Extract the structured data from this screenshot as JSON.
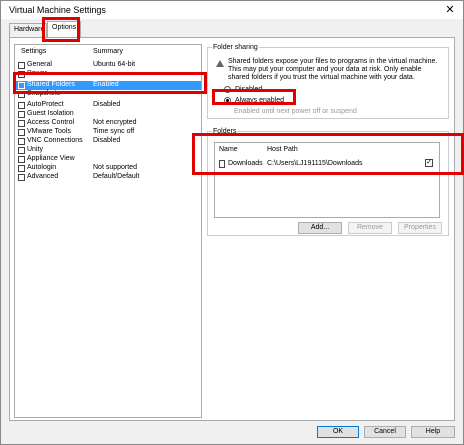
{
  "window": {
    "title": "Virtual Machine Settings",
    "close": "✕"
  },
  "tabs": [
    {
      "label": "Hardware"
    },
    {
      "label": "Options"
    }
  ],
  "list": {
    "header": {
      "settings": "Settings",
      "summary": "Summary"
    },
    "items": [
      {
        "name": "General",
        "value": "Ubuntu 64-bit",
        "icon": "general-icon"
      },
      {
        "name": "Power",
        "value": "",
        "icon": "power-icon"
      },
      {
        "name": "Shared Folders",
        "value": "Enabled",
        "icon": "shared-folders-icon",
        "selected": true
      },
      {
        "name": "Snapshots",
        "value": "",
        "icon": "snapshots-icon"
      },
      {
        "name": "AutoProtect",
        "value": "Disabled",
        "icon": "autoprotect-icon"
      },
      {
        "name": "Guest Isolation",
        "value": "",
        "icon": "guest-isolation-icon"
      },
      {
        "name": "Access Control",
        "value": "Not encrypted",
        "icon": "access-control-icon"
      },
      {
        "name": "VMware Tools",
        "value": "Time sync off",
        "icon": "vmware-tools-icon"
      },
      {
        "name": "VNC Connections",
        "value": "Disabled",
        "icon": "vnc-icon"
      },
      {
        "name": "Unity",
        "value": "",
        "icon": "unity-icon"
      },
      {
        "name": "Appliance View",
        "value": "",
        "icon": "appliance-view-icon"
      },
      {
        "name": "Autologin",
        "value": "Not supported",
        "icon": "autologin-icon"
      },
      {
        "name": "Advanced",
        "value": "Default/Default",
        "icon": "advanced-icon"
      }
    ]
  },
  "folder_sharing": {
    "legend": "Folder sharing",
    "warning": "Shared folders expose your files to programs in the virtual machine. This may put your computer and your data at risk. Only enable shared folders if you trust the virtual machine with your data.",
    "options": [
      {
        "label": "Disabled"
      },
      {
        "label": "Always enabled"
      }
    ],
    "selected": "Always enabled",
    "subnote": "Enabled until next power off or suspend"
  },
  "folders": {
    "legend": "Folders",
    "columns": {
      "name": "Name",
      "host_path": "Host Path"
    },
    "rows": [
      {
        "name": "Downloads",
        "host_path": "C:\\Users\\LJ191115\\Downloads",
        "enabled": true
      }
    ],
    "buttons": {
      "add": "Add...",
      "remove": "Remove",
      "properties": "Properties"
    }
  },
  "footer": {
    "ok": "OK",
    "cancel": "Cancel",
    "help": "Help"
  },
  "colors": {
    "selection": "#3399ff",
    "highlight": "#e00000"
  }
}
